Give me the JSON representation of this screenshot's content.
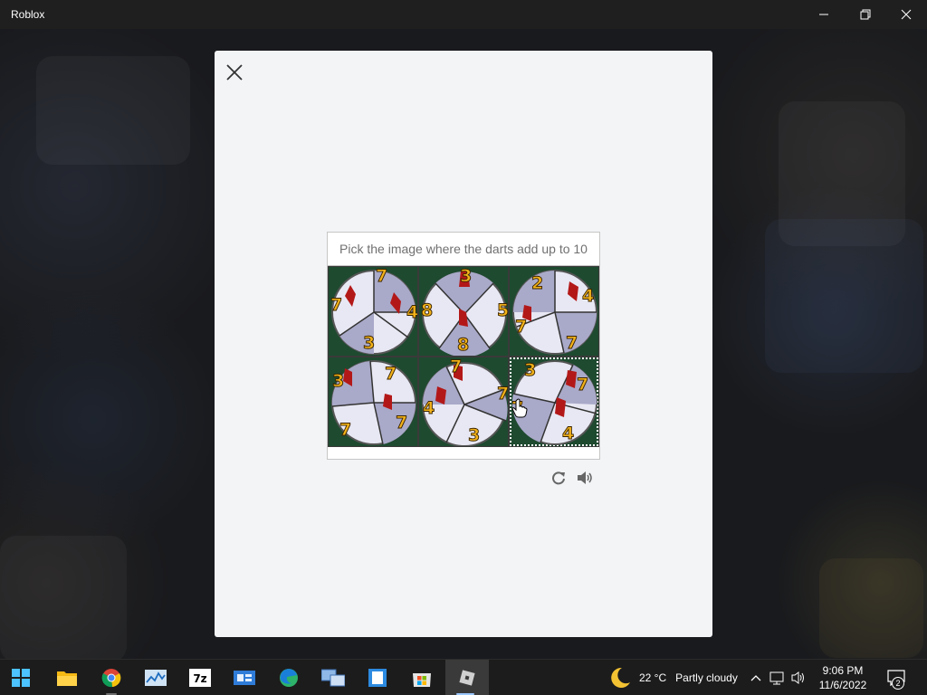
{
  "window": {
    "title": "Roblox",
    "controls": [
      "minimize",
      "restore",
      "close"
    ]
  },
  "captcha": {
    "prompt": "Pick the image where the darts add up to 10",
    "tiles": [
      {
        "numbers": [
          "7",
          "7",
          "4",
          "3"
        ],
        "selected": false
      },
      {
        "numbers": [
          "3",
          "8",
          "5",
          "8"
        ],
        "selected": false
      },
      {
        "numbers": [
          "2",
          "4",
          "7",
          "7"
        ],
        "selected": false
      },
      {
        "numbers": [
          "3",
          "7",
          "7",
          "7"
        ],
        "selected": false
      },
      {
        "numbers": [
          "7",
          "7",
          "4",
          "3"
        ],
        "selected": false
      },
      {
        "numbers": [
          "3",
          "7",
          "7",
          "4"
        ],
        "selected": true
      }
    ],
    "controls": [
      "refresh-icon",
      "audio-icon"
    ]
  },
  "taskbar": {
    "apps": [
      "start-icon",
      "file-explorer-icon",
      "chrome-icon",
      "resource-monitor-icon",
      "7zip-icon",
      "control-panel-icon",
      "edge-icon",
      "remote-desktop-icon",
      "notepad-icon",
      "microsoft-store-icon",
      "roblox-icon"
    ],
    "active_app": "roblox-icon",
    "app_labels": {
      "sevenzip": "7z"
    },
    "weather": {
      "temp": "22 °C",
      "condition": "Partly cloudy"
    },
    "clock": {
      "time": "9:06 PM",
      "date": "11/6/2022"
    },
    "notifications": {
      "count": "2"
    }
  },
  "colors": {
    "accent": "#9bc7ff",
    "dart_number": "#f2b21a",
    "tile_green": "#1e4a30",
    "wheel_light": "#e8e8f4",
    "wheel_shade": "#a9a9c9"
  }
}
